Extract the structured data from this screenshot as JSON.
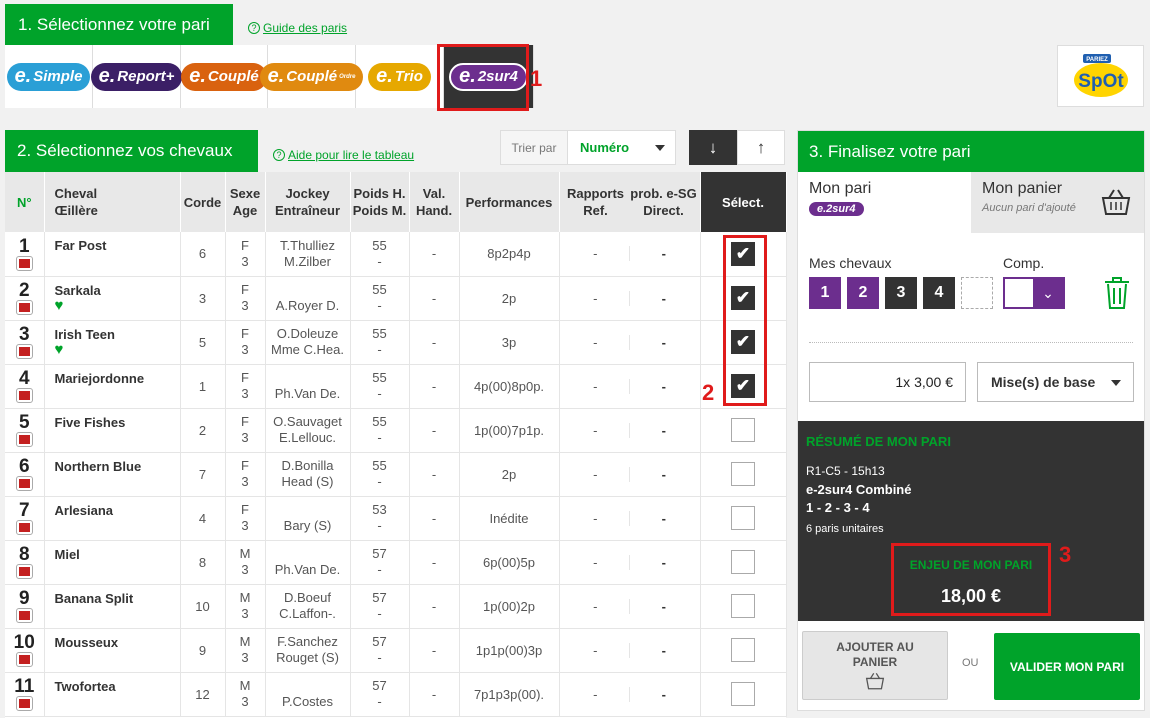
{
  "section1": {
    "title": "1. Sélectionnez votre pari",
    "guide_link": "Guide des paris",
    "bet_types": [
      {
        "e": "e.",
        "name": "Simple",
        "color": "#2a9fd6"
      },
      {
        "e": "e.",
        "name": "Report+",
        "color": "#3b1f66"
      },
      {
        "e": "e.",
        "name": "Couplé",
        "color": "#d9620f"
      },
      {
        "e": "e.",
        "name": "Couplé",
        "sub": "Ordre",
        "color": "#e08a10"
      },
      {
        "e": "e.",
        "name": "Trio",
        "color": "#e6a800"
      },
      {
        "e": "e.",
        "name": "2sur4",
        "color": "#6c2e8e"
      }
    ],
    "annotation": "1"
  },
  "logo": {
    "top": "PARIEZ",
    "name": "SpOt"
  },
  "section2": {
    "title": "2. Sélectionnez vos chevaux",
    "help_link": "Aide pour lire le tableau",
    "sort_label": "Trier par",
    "sort_value": "Numéro",
    "sort_down": "↓",
    "sort_up": "↑",
    "annotation": "2"
  },
  "table": {
    "headers": {
      "no": "N°",
      "cheval": [
        "Cheval",
        "Œillère"
      ],
      "corde": "Corde",
      "sexe": [
        "Sexe",
        "Age"
      ],
      "jockey": [
        "Jockey",
        "Entraîneur"
      ],
      "poids": [
        "Poids H.",
        "Poids M."
      ],
      "val": [
        "Val.",
        "Hand."
      ],
      "perf": "Performances",
      "rapports": [
        "Rapports",
        "Ref."
      ],
      "prob": [
        "prob. e-SG",
        "Direct."
      ],
      "select": "Sélect."
    },
    "rows": [
      {
        "num": "1",
        "name": "Far Post",
        "heart": false,
        "corde": "6",
        "sexe": "F",
        "age": "3",
        "jockey": "T.Thulliez",
        "trainer": "M.Zilber",
        "poids": "55",
        "poidsm": "-",
        "val": "-",
        "perf": "8p2p4p",
        "ref": "-",
        "direct": "-",
        "checked": true
      },
      {
        "num": "2",
        "name": "Sarkala",
        "heart": true,
        "corde": "3",
        "sexe": "F",
        "age": "3",
        "jockey": "",
        "trainer": "A.Royer D.",
        "poids": "55",
        "poidsm": "-",
        "val": "-",
        "perf": "2p",
        "ref": "-",
        "direct": "-",
        "checked": true
      },
      {
        "num": "3",
        "name": "Irish Teen",
        "heart": true,
        "corde": "5",
        "sexe": "F",
        "age": "3",
        "jockey": "O.Doleuze",
        "trainer": "Mme C.Hea.",
        "poids": "55",
        "poidsm": "-",
        "val": "-",
        "perf": "3p",
        "ref": "-",
        "direct": "-",
        "checked": true
      },
      {
        "num": "4",
        "name": "Mariejordonne",
        "heart": false,
        "corde": "1",
        "sexe": "F",
        "age": "3",
        "jockey": "",
        "trainer": "Ph.Van De.",
        "poids": "55",
        "poidsm": "-",
        "val": "-",
        "perf": "4p(00)8p0p.",
        "ref": "-",
        "direct": "-",
        "checked": true
      },
      {
        "num": "5",
        "name": "Five Fishes",
        "heart": false,
        "corde": "2",
        "sexe": "F",
        "age": "3",
        "jockey": "O.Sauvaget",
        "trainer": "E.Lellouc.",
        "poids": "55",
        "poidsm": "-",
        "val": "-",
        "perf": "1p(00)7p1p.",
        "ref": "-",
        "direct": "-",
        "checked": false
      },
      {
        "num": "6",
        "name": "Northern Blue",
        "heart": false,
        "corde": "7",
        "sexe": "F",
        "age": "3",
        "jockey": "D.Bonilla",
        "trainer": "Head (S)",
        "poids": "55",
        "poidsm": "-",
        "val": "-",
        "perf": "2p",
        "ref": "-",
        "direct": "-",
        "checked": false
      },
      {
        "num": "7",
        "name": "Arlesiana",
        "heart": false,
        "corde": "4",
        "sexe": "F",
        "age": "3",
        "jockey": "",
        "trainer": "Bary (S)",
        "poids": "53",
        "poidsm": "-",
        "val": "-",
        "perf": "Inédite",
        "ref": "-",
        "direct": "-",
        "checked": false
      },
      {
        "num": "8",
        "name": "Miel",
        "heart": false,
        "corde": "8",
        "sexe": "M",
        "age": "3",
        "jockey": "",
        "trainer": "Ph.Van De.",
        "poids": "57",
        "poidsm": "-",
        "val": "-",
        "perf": "6p(00)5p",
        "ref": "-",
        "direct": "-",
        "checked": false
      },
      {
        "num": "9",
        "name": "Banana Split",
        "heart": false,
        "corde": "10",
        "sexe": "M",
        "age": "3",
        "jockey": "D.Boeuf",
        "trainer": "C.Laffon-.",
        "poids": "57",
        "poidsm": "-",
        "val": "-",
        "perf": "1p(00)2p",
        "ref": "-",
        "direct": "-",
        "checked": false
      },
      {
        "num": "10",
        "name": "Mousseux",
        "heart": false,
        "corde": "9",
        "sexe": "M",
        "age": "3",
        "jockey": "F.Sanchez",
        "trainer": "Rouget (S)",
        "poids": "57",
        "poidsm": "-",
        "val": "-",
        "perf": "1p1p(00)3p",
        "ref": "-",
        "direct": "-",
        "checked": false
      },
      {
        "num": "11",
        "name": "Twofortea",
        "heart": false,
        "corde": "12",
        "sexe": "M",
        "age": "3",
        "jockey": "",
        "trainer": "P.Costes",
        "poids": "57",
        "poidsm": "-",
        "val": "-",
        "perf": "7p1p3p(00).",
        "ref": "-",
        "direct": "-",
        "checked": false
      }
    ]
  },
  "section3": {
    "title": "3. Finalisez votre pari",
    "tab_mon_pari": "Mon pari",
    "mini_pill": "e.2sur4",
    "tab_panier": "Mon panier",
    "panier_sub": "Aucun pari d'ajouté",
    "mes_chevaux": "Mes chevaux",
    "comp": "Comp.",
    "chips": [
      "1",
      "2",
      "3",
      "4"
    ],
    "mise": "1x 3,00 €",
    "mise_select": "Mise(s) de base",
    "resume_title": "RÉSUMÉ DE MON PARI",
    "race": "R1-C5 - 15h13",
    "bet_name": "e-2sur4 Combiné",
    "horses": "1 - 2 - 3 - 4",
    "unit_bets": "6 paris unitaires",
    "enjeu_label": "ENJEU DE MON PARI",
    "enjeu_value": "18,00 €",
    "annotation": "3",
    "add_cart": "AJOUTER AU PANIER",
    "ou": "OU",
    "validate": "VALIDER MON PARI"
  },
  "colors": {
    "green": "#00a32a",
    "purple": "#6c2e8e",
    "dark": "#333333",
    "red": "#e01b1b"
  }
}
